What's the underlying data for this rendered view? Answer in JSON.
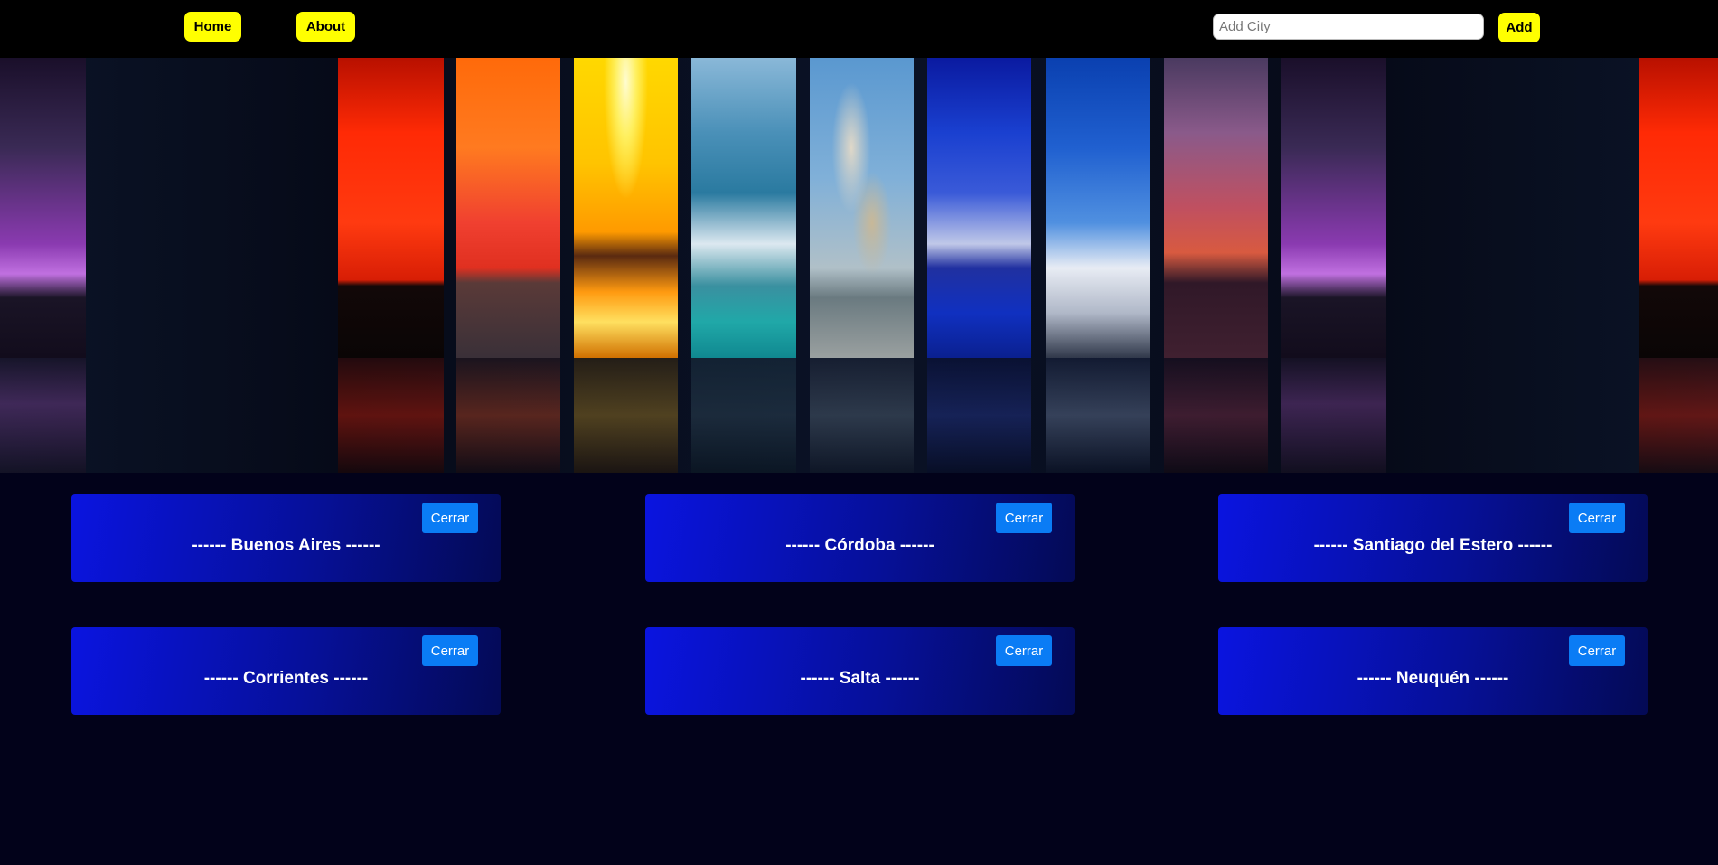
{
  "nav": {
    "home_label": "Home",
    "about_label": "About"
  },
  "search": {
    "placeholder": "Add City",
    "value": "",
    "add_label": "Add"
  },
  "cities": [
    {
      "name": "------ Buenos Aires ------",
      "close_label": "Cerrar"
    },
    {
      "name": "------ Córdoba ------",
      "close_label": "Cerrar"
    },
    {
      "name": "------ Santiago del Estero ------",
      "close_label": "Cerrar"
    },
    {
      "name": "------ Corrientes ------",
      "close_label": "Cerrar"
    },
    {
      "name": "------ Salta ------",
      "close_label": "Cerrar"
    },
    {
      "name": "------ Neuquén ------",
      "close_label": "Cerrar"
    }
  ],
  "colors": {
    "nav_button": "#ffff00",
    "close_button": "#0a7cf5",
    "card_gradient_start": "#0a14e0",
    "card_gradient_end": "#040a55",
    "page_background": "#02021a"
  }
}
